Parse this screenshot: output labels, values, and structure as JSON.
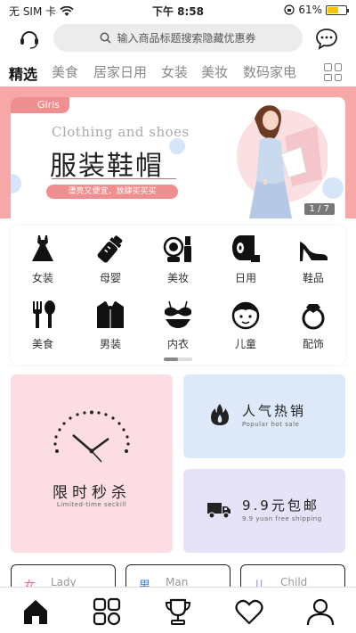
{
  "status_bar": {
    "carrier": "无 SIM 卡",
    "time": "下午 8:58",
    "battery": "61%",
    "battery_level": 0.61
  },
  "header": {
    "left_icon": "customer-service-icon",
    "search_placeholder": "输入商品标题搜索隐藏优惠券",
    "right_icon": "message-icon"
  },
  "tabs": [
    "精选",
    "美食",
    "居家日用",
    "女装",
    "美妆",
    "数码家电"
  ],
  "banner": {
    "tag": "Girls",
    "subtitle": "Clothing and shoes",
    "title": "服装鞋帽",
    "slogan": "漂亮又便宜，放肆买买买",
    "page": "1 / 7"
  },
  "categories": [
    {
      "label": "女装",
      "icon": "dress-icon"
    },
    {
      "label": "母婴",
      "icon": "baby-bottle-icon"
    },
    {
      "label": "美妆",
      "icon": "cosmetics-icon"
    },
    {
      "label": "日用",
      "icon": "tissue-roll-icon"
    },
    {
      "label": "鞋品",
      "icon": "high-heel-icon"
    },
    {
      "label": "美食",
      "icon": "fork-spoon-icon"
    },
    {
      "label": "男装",
      "icon": "suit-icon"
    },
    {
      "label": "内衣",
      "icon": "lingerie-icon"
    },
    {
      "label": "儿童",
      "icon": "child-face-icon"
    },
    {
      "label": "配饰",
      "icon": "ring-icon"
    }
  ],
  "promos": {
    "flash": {
      "title": "限时秒杀",
      "subtitle": "Limited-time seckill"
    },
    "hot": {
      "title": "人气热销",
      "subtitle": "Popular hot sale"
    },
    "shipping": {
      "title": "9.9元包邮",
      "subtitle": "9.9 yuan free shipping"
    }
  },
  "gender_tabs": [
    {
      "icon_char": "女",
      "label": "Lady",
      "color": "#e86a8a"
    },
    {
      "icon_char": "男",
      "label": "Man",
      "color": "#4a7fd8"
    },
    {
      "icon_char": "儿",
      "label": "Child",
      "color": "#8a7fd8"
    }
  ],
  "bottom_nav": [
    "home-icon",
    "category-grid-icon",
    "trophy-icon",
    "heart-icon",
    "profile-icon"
  ],
  "colors": {
    "banner_pink": "#f7a7a5",
    "accent_pink": "#f08f8f",
    "battery_yellow": "#f5c400"
  }
}
